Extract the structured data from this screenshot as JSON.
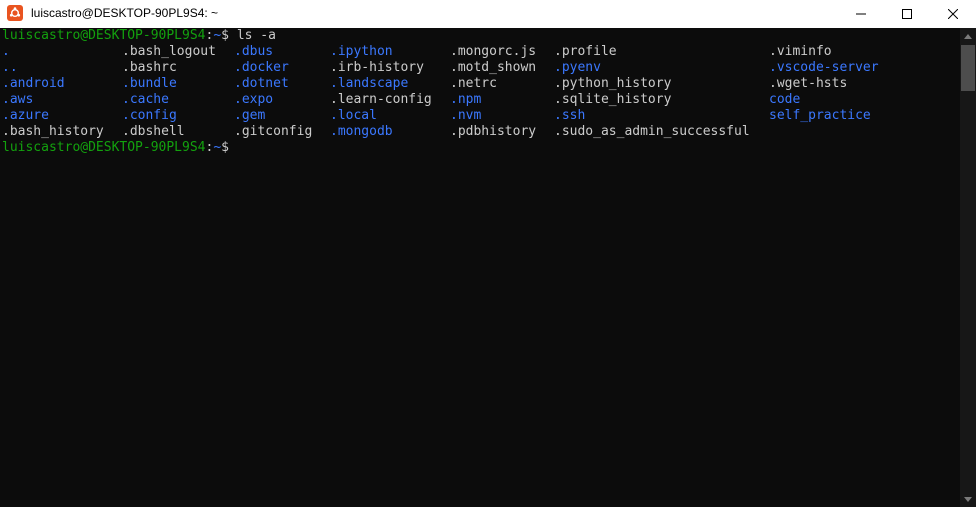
{
  "window": {
    "title": "luiscastro@DESKTOP-90PL9S4: ~",
    "app_icon": "ubuntu-icon",
    "controls": {
      "minimize_icon": "minimize-icon",
      "maximize_icon": "maximize-icon",
      "close_icon": "close-icon"
    }
  },
  "colors": {
    "background": "#0c0c0c",
    "text": "#cccccc",
    "prompt_user": "#13a10e",
    "prompt_path": "#3b78ff",
    "directory": "#3b78ff"
  },
  "terminal": {
    "prompt1": {
      "user": "luiscastro@DESKTOP-90PL9S4",
      "sep": ":",
      "path": "~",
      "symbol": "$ ",
      "command": "ls -a"
    },
    "listing": [
      {
        "col1": ".",
        "col2": ".bash_logout",
        "col3": ".dbus",
        "col4": ".ipython",
        "col5": ".mongorc.js",
        "col6": ".profile",
        "col7": ".viminfo"
      },
      {
        "col1": "..",
        "col2": ".bashrc",
        "col3": ".docker",
        "col4": ".irb-history",
        "col5": ".motd_shown",
        "col6": ".pyenv",
        "col7": ".vscode-server"
      },
      {
        "col1": ".android",
        "col2": ".bundle",
        "col3": ".dotnet",
        "col4": ".landscape",
        "col5": ".netrc",
        "col6": ".python_history",
        "col7": ".wget-hsts"
      },
      {
        "col1": ".aws",
        "col2": ".cache",
        "col3": ".expo",
        "col4": ".learn-config",
        "col5": ".npm",
        "col6": ".sqlite_history",
        "col7": "code"
      },
      {
        "col1": ".azure",
        "col2": ".config",
        "col3": ".gem",
        "col4": ".local",
        "col5": ".nvm",
        "col6": ".ssh",
        "col7": "self_practice"
      },
      {
        "col1": ".bash_history",
        "col2": ".dbshell",
        "col3": ".gitconfig",
        "col4": ".mongodb",
        "col5": ".pdbhistory",
        "col6": ".sudo_as_admin_successful",
        "col7": ""
      }
    ],
    "prompt2": {
      "user": "luiscastro@DESKTOP-90PL9S4",
      "sep": ":",
      "path": "~",
      "symbol": "$ "
    }
  },
  "scrollbar": {
    "up_icon": "scroll-up-arrow-icon",
    "down_icon": "scroll-down-arrow-icon"
  }
}
